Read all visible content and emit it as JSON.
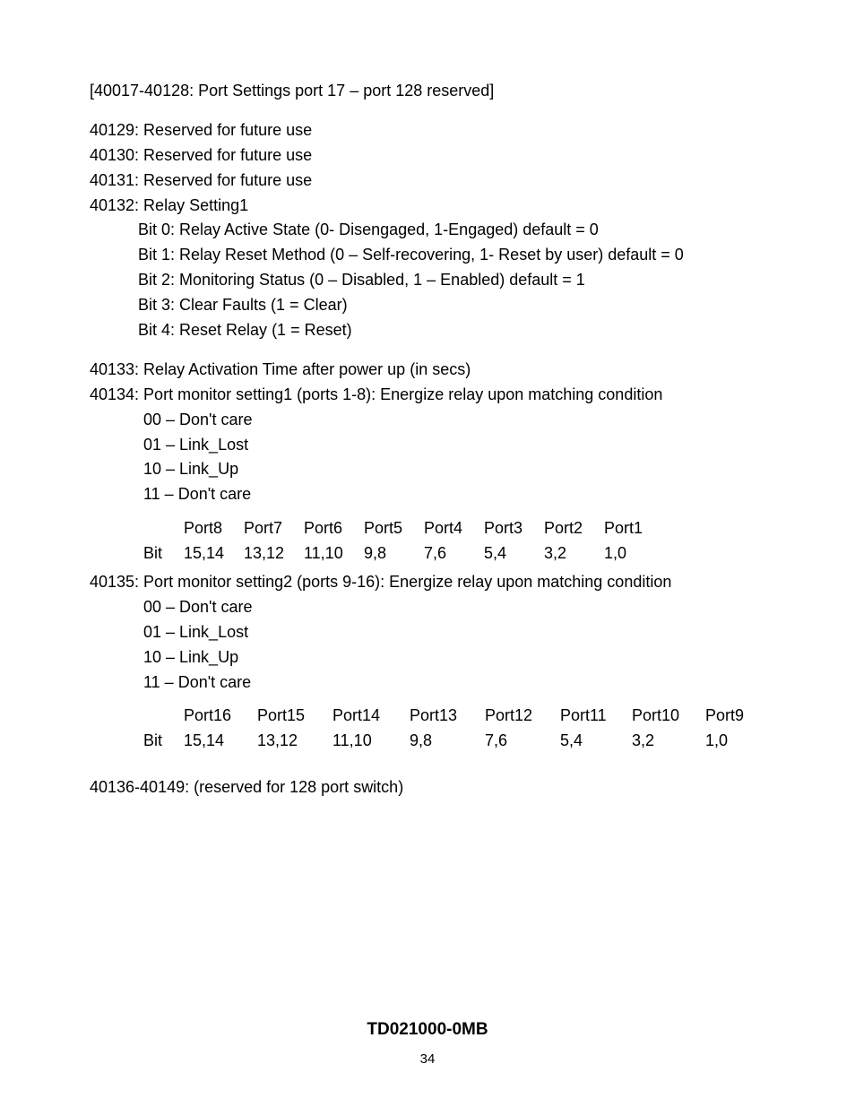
{
  "line_header": "[40017-40128: Port Settings port 17 – port 128 reserved]",
  "r40129": "40129:  Reserved for future use",
  "r40130": "40130:  Reserved for future use",
  "r40131": "40131:  Reserved for future use",
  "r40132": {
    "title": "40132: Relay Setting1",
    "bit0": "Bit 0: Relay Active State (0- Disengaged, 1-Engaged) default = 0",
    "bit1": "Bit 1: Relay Reset Method (0 – Self-recovering, 1- Reset by user) default = 0",
    "bit2": "Bit 2: Monitoring Status (0 – Disabled, 1 – Enabled) default = 1",
    "bit3": "Bit 3: Clear Faults (1 = Clear)",
    "bit4": "Bit 4: Reset Relay (1 = Reset)"
  },
  "r40133": "40133: Relay Activation Time after power up (in secs)",
  "r40134": {
    "title": "40134: Port monitor setting1 (ports 1-8):  Energize relay upon matching condition",
    "c00": "00 – Don't care",
    "c01": "01 – Link_Lost",
    "c10": "10 – Link_Up",
    "c11": "11 – Don't care",
    "ports_row": [
      "Port8",
      "Port7",
      "Port6",
      "Port5",
      "Port4",
      "Port3",
      "Port2",
      "Port1"
    ],
    "bits_label": "Bit",
    "bits_row": [
      "15,14",
      "13,12",
      "11,10",
      "9,8",
      "7,6",
      "5,4",
      "3,2",
      "1,0"
    ]
  },
  "r40135": {
    "title": "40135: Port monitor setting2 (ports 9-16):  Energize relay upon matching condition",
    "c00": "00 – Don't care",
    "c01": "01 – Link_Lost",
    "c10": "10 – Link_Up",
    "c11": "11 – Don't care",
    "ports_row": [
      "Port16",
      "Port15",
      "Port14",
      "Port13",
      "Port12",
      "Port11",
      "Port10",
      "Port9"
    ],
    "bits_label": "Bit",
    "bits_row": [
      "15,14",
      "13,12",
      "11,10",
      "9,8",
      "7,6",
      "5,4",
      "3,2",
      "1,0"
    ]
  },
  "r40136": "40136-40149: (reserved for 128 port switch)",
  "footer": {
    "docid": "TD021000-0MB",
    "page": "34"
  }
}
